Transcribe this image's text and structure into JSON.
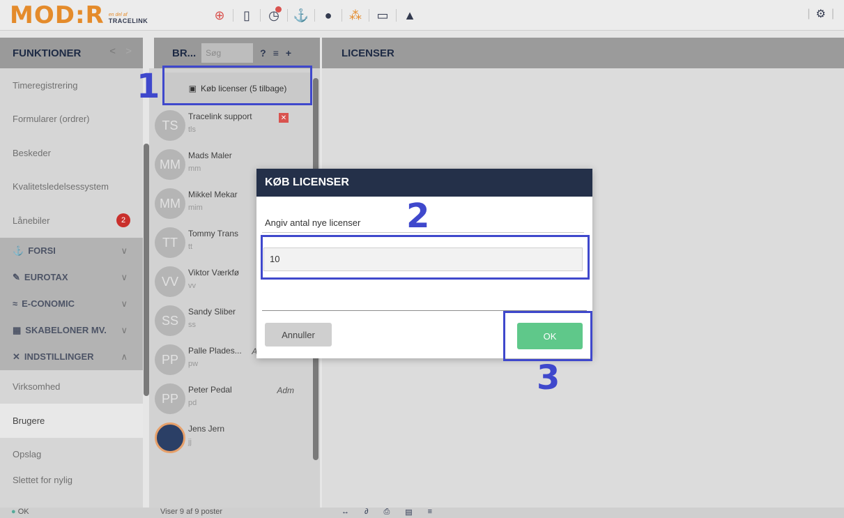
{
  "topbar": {
    "logo_main": "MOD:R",
    "logo_sub_a": "en del af",
    "logo_sub_b": "TRACELINK",
    "tools": [
      {
        "icon": "lifebuoy-icon",
        "glyph": "⊕"
      },
      {
        "icon": "mobile-icon",
        "glyph": "▯"
      },
      {
        "icon": "clock-icon",
        "glyph": "◷"
      },
      {
        "icon": "anchor-icon",
        "glyph": "⚓"
      },
      {
        "icon": "chat-icon",
        "glyph": "●"
      },
      {
        "icon": "network-icon",
        "glyph": "⁂"
      },
      {
        "icon": "card-icon",
        "glyph": "▭"
      },
      {
        "icon": "warning-icon",
        "glyph": "▲"
      }
    ],
    "settings_glyph": "⚙"
  },
  "headers": {
    "functions": "FUNKTIONER",
    "nav_back": "<",
    "nav_forward": ">",
    "users": "BR...",
    "search_placeholder": "Søg",
    "help": "?",
    "layers": "≡",
    "add": "+",
    "licenses": "LICENSER"
  },
  "sidebar": {
    "items": [
      {
        "label": "Timeregistrering"
      },
      {
        "label": "Formularer (ordrer)"
      },
      {
        "label": "Beskeder"
      },
      {
        "label": "Kvalitetsledelsessystem"
      },
      {
        "label": "Lånebiler",
        "badge": "2"
      }
    ],
    "groups": [
      {
        "label": "FORSI",
        "glyph": "⚓",
        "chev": "∨"
      },
      {
        "label": "EUROTAX",
        "glyph": "✎",
        "chev": "∨"
      },
      {
        "label": "E-CONOMIC",
        "glyph": "≈",
        "chev": "∨"
      },
      {
        "label": "SKABELONER MV.",
        "glyph": "▦",
        "chev": "∨"
      },
      {
        "label": "INDSTILLINGER",
        "glyph": "✕",
        "chev": "∧"
      }
    ],
    "sub_items": [
      {
        "label": "Virksomhed"
      },
      {
        "label": "Brugere"
      },
      {
        "label": "Opslag"
      },
      {
        "label": "Slettet for nylig"
      }
    ]
  },
  "userlist": {
    "buy_button": "Køb licenser (5 tilbage)",
    "users": [
      {
        "initials": "TS",
        "name": "Tracelink support",
        "login": "tls"
      },
      {
        "initials": "MM",
        "name": "Mads Maler",
        "login": "mm"
      },
      {
        "initials": "MM",
        "name": "Mikkel Mekar",
        "login": "mim"
      },
      {
        "initials": "TT",
        "name": "Tommy Trans",
        "login": "tt"
      },
      {
        "initials": "VV",
        "name": "Viktor Værkfø",
        "login": "vv"
      },
      {
        "initials": "SS",
        "name": "Sandy Sliber",
        "login": "ss"
      },
      {
        "initials": "PP",
        "name": "Palle Plades...",
        "login": "pw",
        "role": "Adm"
      },
      {
        "initials": "PP",
        "name": "Peter Pedal",
        "login": "pd",
        "role": "Adm"
      },
      {
        "initials": "",
        "name": "Jens Jern",
        "login": "jj"
      }
    ]
  },
  "dialog": {
    "title": "KØB LICENSER",
    "label": "Angiv antal nye licenser",
    "value": "10",
    "cancel": "Annuller",
    "ok": "OK"
  },
  "bottombar": {
    "status": "OK",
    "count": "Viser 9 af 9 poster"
  },
  "annotations": [
    "1",
    "2",
    "3"
  ],
  "colors": {
    "accent_orange": "#e48b2b",
    "navy": "#243049",
    "ok_green": "#5fc88a",
    "annotation_blue": "#3f48cc",
    "badge_red": "#c9302c"
  }
}
